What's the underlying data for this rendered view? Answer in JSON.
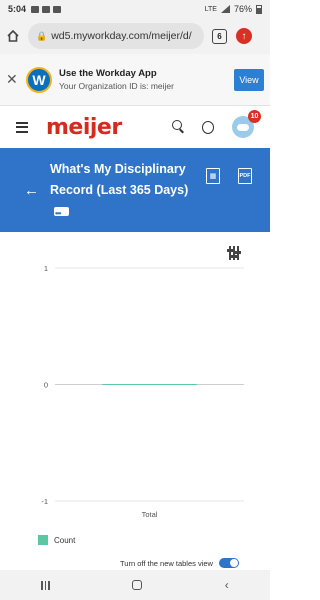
{
  "status": {
    "time": "5:04",
    "battery": "76%",
    "network": "LTE"
  },
  "browser": {
    "url": "wd5.myworkday.com/meijer/d/",
    "tab_count": "6"
  },
  "banner": {
    "title": "Use the Workday App",
    "subtitle": "Your Organization ID is: meijer",
    "view_label": "View",
    "logo_letter": "W"
  },
  "header": {
    "brand": "meijer",
    "notification_count": "10"
  },
  "page": {
    "title": "What's My Disciplinary Record (Last 365 Days)"
  },
  "icons": {
    "excel": "excel-export-icon",
    "pdf": "pdf-export-icon",
    "settings": "chart-settings-icon"
  },
  "chart_data": {
    "type": "bar",
    "categories": [
      "Total"
    ],
    "series": [
      {
        "name": "Count",
        "values": [
          0
        ]
      }
    ],
    "ylim": [
      -1,
      1
    ],
    "yticks": [
      "1",
      "0",
      "-1"
    ],
    "xlabel": "Total",
    "ylabel": "",
    "title": "",
    "legend_position": "bottom-left",
    "series_color": "#5cc7a3"
  },
  "footer": {
    "toggle_label": "Turn off the new tables view",
    "toggle_on": true
  },
  "colors": {
    "brand_red": "#d52b1e",
    "header_blue": "#2f74c8"
  }
}
